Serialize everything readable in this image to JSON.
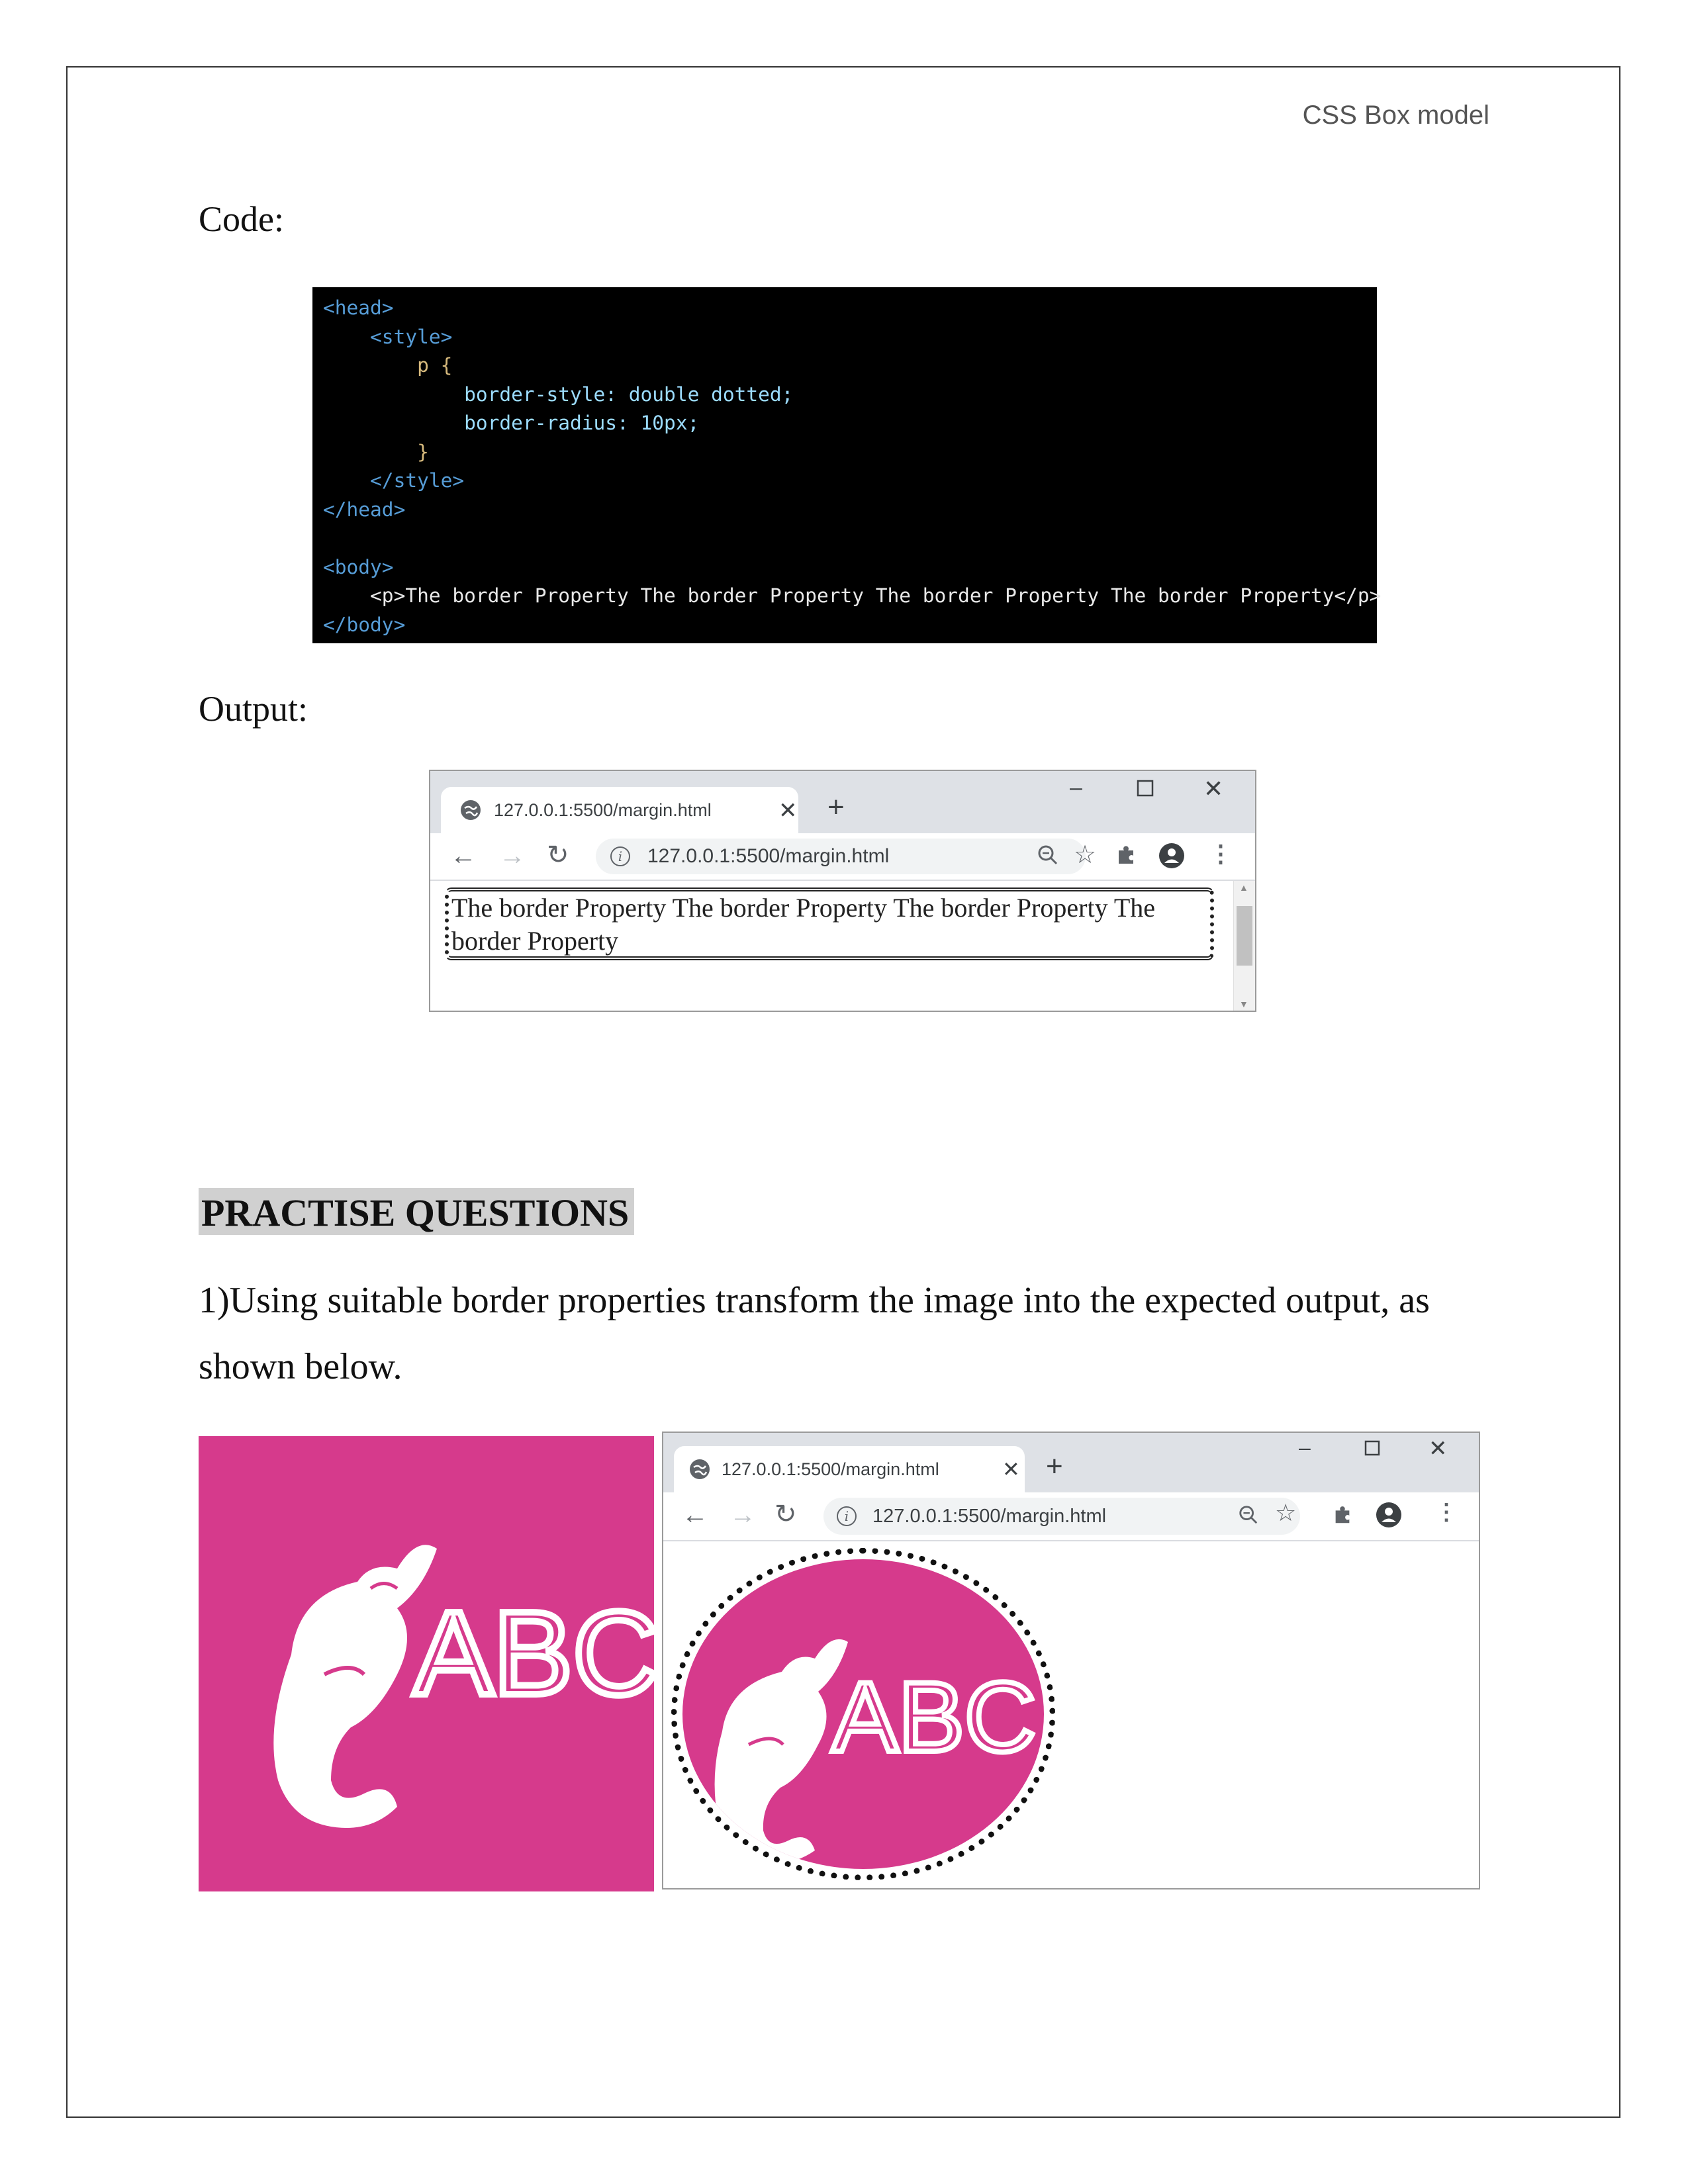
{
  "header": {
    "running_title": "CSS Box model"
  },
  "code_section": {
    "label": "Code:",
    "lines": [
      "<head>",
      "    <style>",
      "        p {",
      "            border-style: double dotted;",
      "            border-radius: 10px;",
      "        }",
      "    </style>",
      "</head>",
      "",
      "<body>",
      "    <p>The border Property The border Property The border Property The border Property</p>",
      "</body>"
    ]
  },
  "output_section": {
    "label": "Output:",
    "browser": {
      "tab_title": "127.0.0.1:5500/margin.html",
      "url": "127.0.0.1:5500/margin.html",
      "paragraph_text": "The border Property The border Property The border Property The border Property"
    }
  },
  "practise": {
    "heading": "PRACTISE QUESTIONS",
    "question_1": "1)Using suitable border properties transform the image into the expected output, as shown below.",
    "logo_text": "ABC",
    "browser": {
      "tab_title": "127.0.0.1:5500/margin.html",
      "url": "127.0.0.1:5500/margin.html"
    }
  },
  "icons": {
    "favicon": "globe-icon",
    "close_tab": "close-icon",
    "new_tab": "plus-icon",
    "minimize": "minimize-icon",
    "maximize": "maximize-icon",
    "close_window": "close-window-icon",
    "back": "arrow-left-icon",
    "forward": "arrow-right-icon",
    "reload": "reload-icon",
    "info": "info-icon",
    "zoom": "zoom-icon",
    "bookmark": "star-icon",
    "extensions": "puzzle-icon",
    "profile": "profile-icon",
    "menu": "kebab-menu-icon"
  },
  "colors": {
    "logo_pink": "#d63a8c",
    "code_background": "#000000",
    "heading_highlight": "#d0d0d0"
  }
}
